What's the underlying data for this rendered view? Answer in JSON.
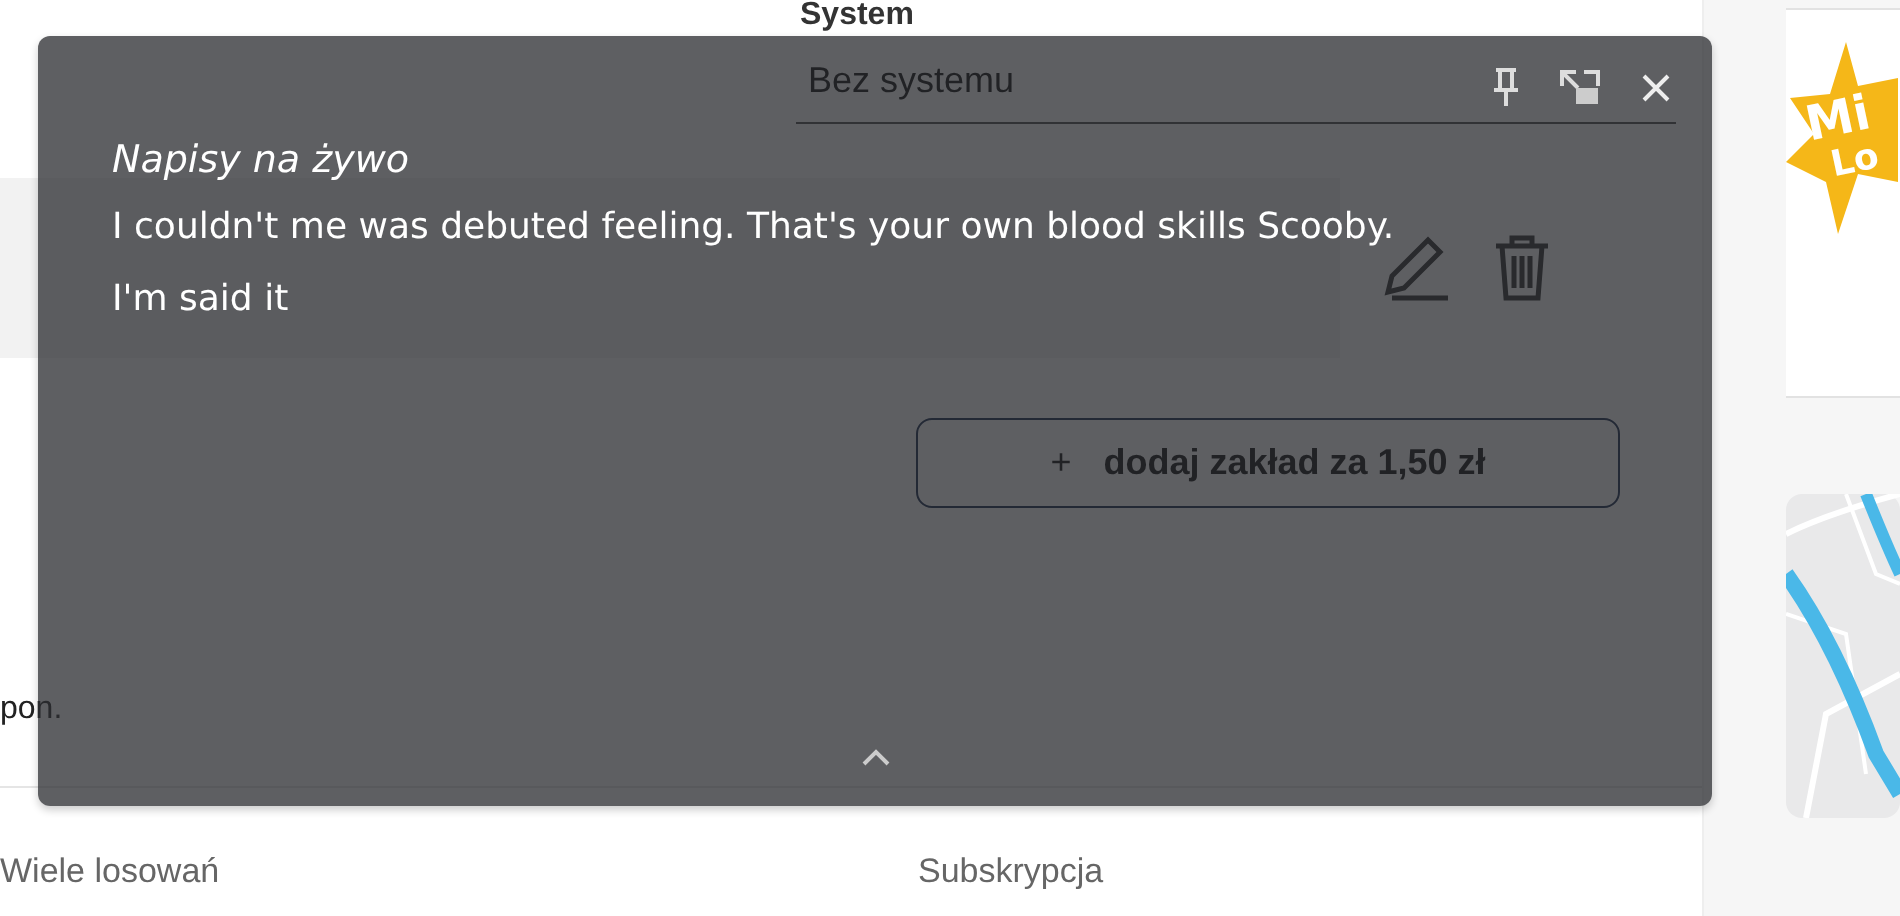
{
  "page": {
    "system_label": "System",
    "system_field": {
      "value": "Bez systemu"
    },
    "add_bet_button": {
      "icon": "+",
      "label": "dodaj zakład za 1,50 zł"
    },
    "note": "pon.",
    "options": [
      "Wiele losowań",
      "Subskrypcja"
    ]
  },
  "sidebar": {
    "logo": {
      "lines": [
        "Mi",
        "Lo"
      ]
    }
  },
  "live_captions": {
    "title": "Napisy na żywo",
    "text": "I couldn't me was debuted feeling. That's your own blood skills Scooby. I'm said it"
  }
}
